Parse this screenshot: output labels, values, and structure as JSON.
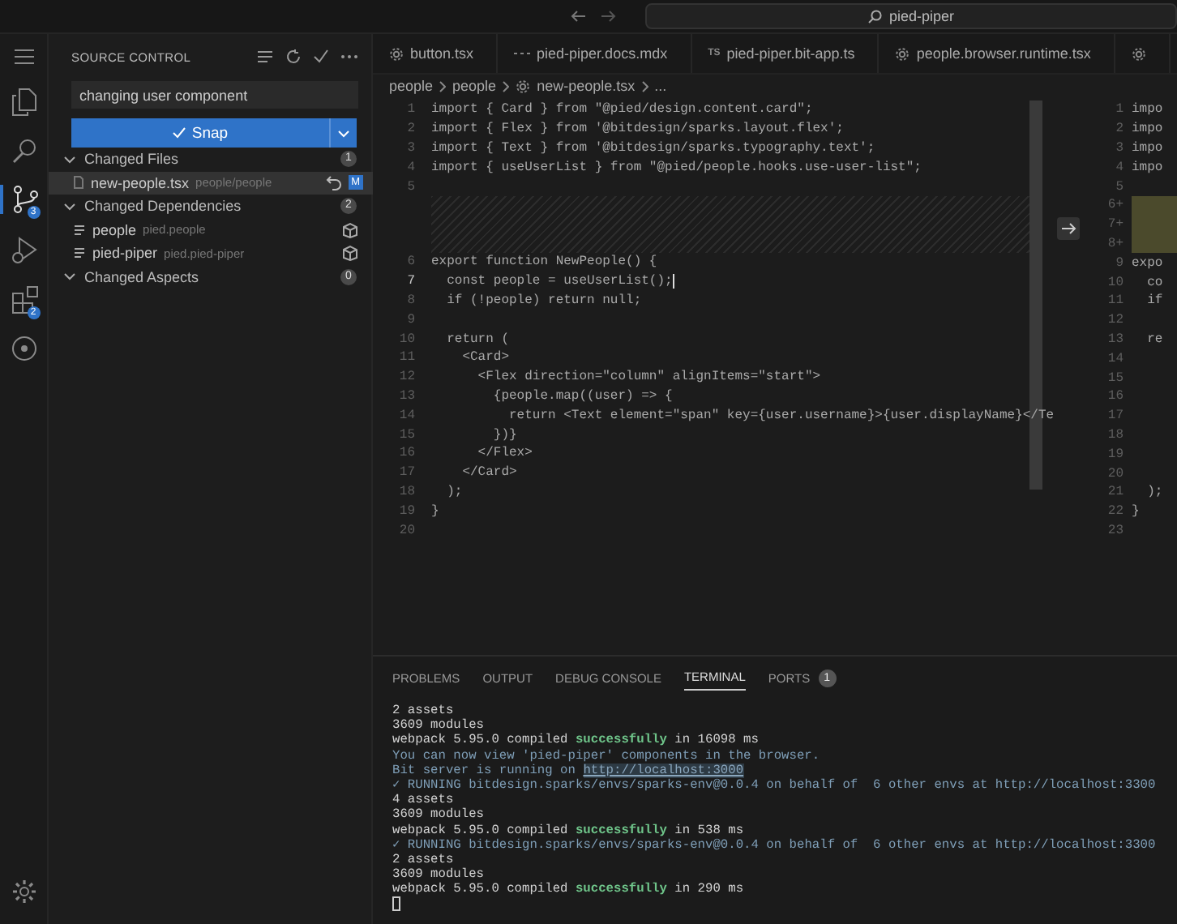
{
  "title_bar": {
    "search": "pied-piper"
  },
  "activity_bar": {
    "badges": [
      {
        "kind": "source-control",
        "count": "3",
        "selected": true
      },
      {
        "kind": "extensions",
        "count": "2",
        "selected": false
      }
    ]
  },
  "sidebar": {
    "title": "SOURCE CONTROL",
    "commit_message": {
      "value": "changing user component"
    },
    "snap_button": "Snap",
    "sections": [
      {
        "label": "Changed Files",
        "count": "1",
        "expanded": true,
        "items": [
          {
            "kind": "file",
            "name": "new-people.tsx",
            "path": "people/people",
            "status": "M",
            "selected": true
          }
        ]
      },
      {
        "label": "Changed Dependencies",
        "count": "2",
        "expanded": true,
        "items": [
          {
            "kind": "dependency",
            "name": "people",
            "path": "pied.people",
            "selected": false
          },
          {
            "kind": "dependency",
            "name": "pied-piper",
            "path": "pied.pied-piper",
            "selected": false
          }
        ]
      },
      {
        "label": "Changed Aspects",
        "count": "0",
        "expanded": true
      }
    ]
  },
  "tabs": [
    {
      "kind": "gear",
      "label": "button.tsx",
      "selected": false
    },
    {
      "kind": "mdx",
      "label": "pied-piper.docs.mdx",
      "selected": false
    },
    {
      "kind": "ts",
      "icon_text": "TS",
      "label": "pied-piper.bit-app.ts",
      "selected": false
    },
    {
      "kind": "gear",
      "label": "people.browser.runtime.tsx",
      "selected": false
    },
    {
      "kind": "gear",
      "selected": false
    }
  ],
  "breadcrumb": [
    "people",
    "people",
    "new-people.tsx",
    "..."
  ],
  "editor": {
    "left_lines": [
      {
        "kind": "code",
        "n": "1",
        "text": "import { Card } from \"@pied/design.content.card\";",
        "current": false
      },
      {
        "kind": "code",
        "n": "2",
        "text": "import { Flex } from '@bitdesign/sparks.layout.flex';",
        "current": false
      },
      {
        "kind": "code",
        "n": "3",
        "text": "import { Text } from '@bitdesign/sparks.typography.text';",
        "current": false
      },
      {
        "kind": "code",
        "n": "4",
        "text": "import { useUserList } from \"@pied/people.hooks.use-user-list\";",
        "current": false
      },
      {
        "kind": "code",
        "n": "5",
        "current": false
      },
      {
        "kind": "gap"
      },
      {
        "kind": "code",
        "n": "6",
        "text": "export function NewPeople() {",
        "current": false
      },
      {
        "kind": "code",
        "n": "7",
        "text": "  const people = useUserList();",
        "current": true
      },
      {
        "kind": "code",
        "n": "8",
        "text": "  if (!people) return null;",
        "current": false
      },
      {
        "kind": "code",
        "n": "9",
        "current": false
      },
      {
        "kind": "code",
        "n": "10",
        "text": "  return (",
        "current": false
      },
      {
        "kind": "code",
        "n": "11",
        "text": "    <Card>",
        "current": false
      },
      {
        "kind": "code",
        "n": "12",
        "text": "      <Flex direction=\"column\" alignItems=\"start\">",
        "current": false
      },
      {
        "kind": "code",
        "n": "13",
        "text": "        {people.map((user) => {",
        "current": false
      },
      {
        "kind": "code",
        "n": "14",
        "text": "          return <Text element=\"span\" key={user.username}>{user.displayName}</Te",
        "current": false
      },
      {
        "kind": "code",
        "n": "15",
        "text": "        })}",
        "current": false
      },
      {
        "kind": "code",
        "n": "16",
        "text": "      </Flex>",
        "current": false
      },
      {
        "kind": "code",
        "n": "17",
        "text": "    </Card>",
        "current": false
      },
      {
        "kind": "code",
        "n": "18",
        "text": "  );",
        "current": false
      },
      {
        "kind": "code",
        "n": "19",
        "text": "}",
        "current": false
      },
      {
        "kind": "code",
        "n": "20",
        "current": false
      }
    ],
    "right_lines": [
      {
        "kind": "code",
        "n": "1",
        "text": "impo"
      },
      {
        "kind": "code",
        "n": "2",
        "text": "impo"
      },
      {
        "kind": "code",
        "n": "3",
        "text": "impo"
      },
      {
        "kind": "code",
        "n": "4",
        "text": "impo"
      },
      {
        "kind": "code",
        "n": "5"
      },
      {
        "kind": "added",
        "n": "6+"
      },
      {
        "kind": "added",
        "n": "7+"
      },
      {
        "kind": "added",
        "n": "8+"
      },
      {
        "kind": "code",
        "n": "9",
        "text": "expo"
      },
      {
        "kind": "code",
        "n": "10",
        "text": "  co"
      },
      {
        "kind": "code",
        "n": "11",
        "text": "  if"
      },
      {
        "kind": "code",
        "n": "12"
      },
      {
        "kind": "code",
        "n": "13",
        "text": "  re"
      },
      {
        "kind": "code",
        "n": "14"
      },
      {
        "kind": "code",
        "n": "15"
      },
      {
        "kind": "code",
        "n": "16"
      },
      {
        "kind": "code",
        "n": "17"
      },
      {
        "kind": "code",
        "n": "18"
      },
      {
        "kind": "code",
        "n": "19"
      },
      {
        "kind": "code",
        "n": "20"
      },
      {
        "kind": "code",
        "n": "21",
        "text": "  );"
      },
      {
        "kind": "code",
        "n": "22",
        "text": "}"
      },
      {
        "kind": "code",
        "n": "23"
      }
    ]
  },
  "panel": {
    "tabs": [
      {
        "label": "PROBLEMS",
        "selected": false
      },
      {
        "label": "OUTPUT",
        "selected": false
      },
      {
        "label": "DEBUG CONSOLE",
        "selected": false
      },
      {
        "label": "TERMINAL",
        "selected": true
      },
      {
        "label": "PORTS",
        "badge": "1",
        "selected": false
      }
    ],
    "terminal": [
      [
        {
          "kind": "plain",
          "text": "2 assets"
        }
      ],
      [
        {
          "kind": "plain",
          "text": "3609 modules"
        }
      ],
      [
        {
          "kind": "plain",
          "text": "webpack 5.95.0 compiled "
        },
        {
          "kind": "success",
          "text": "successfully"
        },
        {
          "kind": "plain",
          "text": " in 16098 ms"
        }
      ],
      [
        {
          "kind": "info",
          "text": "You can now view 'pied-piper' components in the browser."
        }
      ],
      [
        {
          "kind": "info",
          "text": "Bit server is running on "
        },
        {
          "kind": "link",
          "text": "http://localhost:3000"
        }
      ],
      [
        {
          "kind": "info",
          "text": "✓ RUNNING bitdesign.sparks/envs/sparks-env@0.0.4 on behalf of  6 other envs at http://localhost:3300"
        }
      ],
      [
        {
          "kind": "plain",
          "text": "4 assets"
        }
      ],
      [
        {
          "kind": "plain",
          "text": "3609 modules"
        }
      ],
      [
        {
          "kind": "plain",
          "text": "webpack 5.95.0 compiled "
        },
        {
          "kind": "success",
          "text": "successfully"
        },
        {
          "kind": "plain",
          "text": " in 538 ms"
        }
      ],
      [
        {
          "kind": "info",
          "text": "✓ RUNNING bitdesign.sparks/envs/sparks-env@0.0.4 on behalf of  6 other envs at http://localhost:3300"
        }
      ],
      [
        {
          "kind": "plain",
          "text": "2 assets"
        }
      ],
      [
        {
          "kind": "plain",
          "text": "3609 modules"
        }
      ],
      [
        {
          "kind": "plain",
          "text": "webpack 5.95.0 compiled "
        },
        {
          "kind": "success",
          "text": "successfully"
        },
        {
          "kind": "plain",
          "text": " in 290 ms"
        }
      ]
    ]
  }
}
